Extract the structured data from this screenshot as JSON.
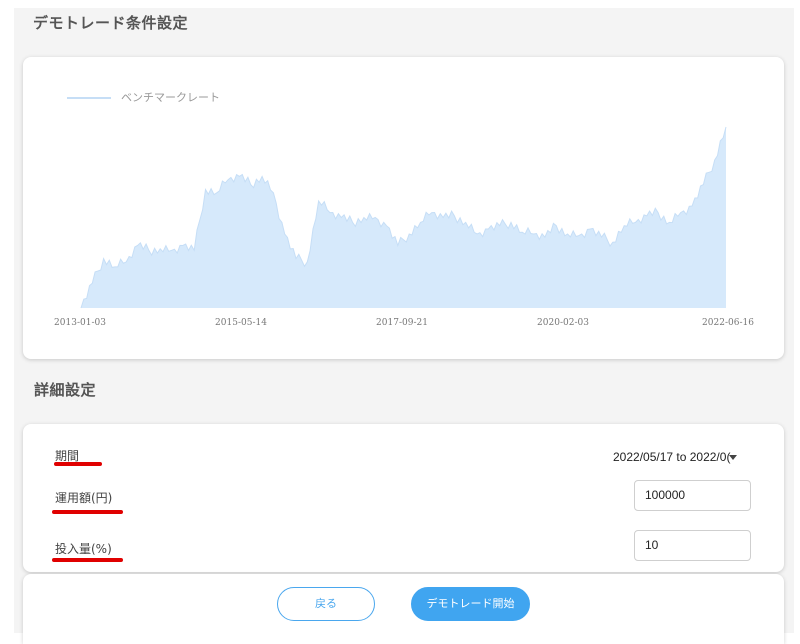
{
  "header": {
    "title": "デモトレード条件設定"
  },
  "chart_data": {
    "type": "area",
    "legend": [
      "ベンチマークレート"
    ],
    "legend_placement": "top-left",
    "color": "#d6e9fb",
    "line_color": "#c6def6",
    "x_ticks": [
      "2013-01-03",
      "2015-05-14",
      "2017-09-21",
      "2020-02-03",
      "2022-06-16"
    ],
    "grid": false,
    "series": [
      {
        "name": "ベンチマークレート",
        "x": [
          "2013-01",
          "2013-03",
          "2013-05",
          "2013-07",
          "2013-09",
          "2013-11",
          "2014-01",
          "2014-03",
          "2014-05",
          "2014-07",
          "2014-09",
          "2014-11",
          "2015-01",
          "2015-03",
          "2015-05",
          "2015-07",
          "2015-09",
          "2015-11",
          "2016-01",
          "2016-03",
          "2016-05",
          "2016-07",
          "2016-09",
          "2016-11",
          "2017-01",
          "2017-03",
          "2017-05",
          "2017-07",
          "2017-09",
          "2017-11",
          "2018-01",
          "2018-03",
          "2018-05",
          "2018-07",
          "2018-09",
          "2018-11",
          "2019-01",
          "2019-03",
          "2019-05",
          "2019-07",
          "2019-09",
          "2019-11",
          "2020-01",
          "2020-03",
          "2020-05",
          "2020-07",
          "2020-09",
          "2020-11",
          "2021-01",
          "2021-03",
          "2021-05",
          "2021-07",
          "2021-09",
          "2021-11",
          "2022-01",
          "2022-03",
          "2022-05",
          "2022-06"
        ],
        "values": [
          0,
          15,
          30,
          25,
          28,
          38,
          35,
          36,
          35,
          38,
          35,
          72,
          70,
          78,
          80,
          75,
          80,
          70,
          45,
          30,
          28,
          65,
          58,
          55,
          52,
          55,
          55,
          50,
          38,
          45,
          52,
          58,
          55,
          56,
          52,
          45,
          48,
          50,
          52,
          46,
          45,
          43,
          50,
          45,
          44,
          48,
          43,
          40,
          50,
          52,
          56,
          58,
          52,
          58,
          62,
          75,
          90,
          110
        ]
      }
    ]
  },
  "details": {
    "title": "詳細設定",
    "period_label": "期間",
    "period_value": "2022/05/17 to 2022/0(",
    "amount_label": "運用額(円)",
    "amount_value": "100000",
    "ratio_label": "投入量(%)",
    "ratio_value": "10"
  },
  "footer": {
    "back_label": "戻る",
    "start_label": "デモトレード開始"
  }
}
